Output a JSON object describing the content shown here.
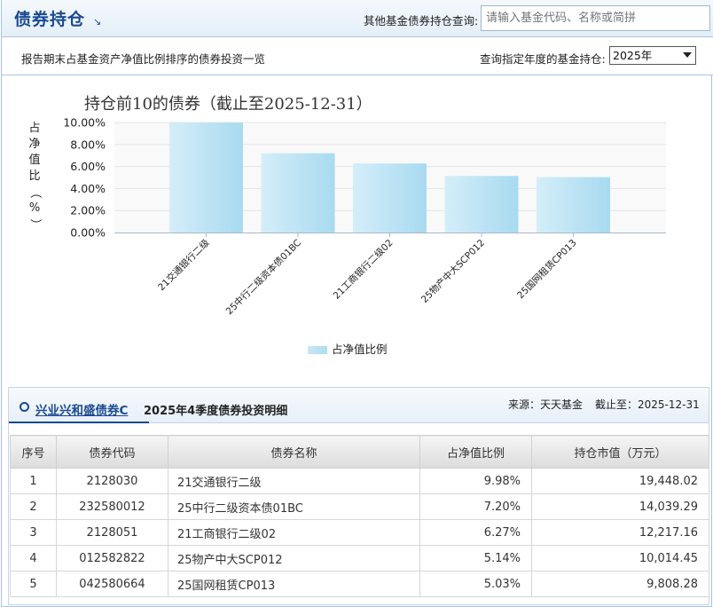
{
  "header": {
    "title": "债券持仓",
    "search_label": "其他基金债券持仓查询:",
    "search_placeholder": "请输入基金代码、名称或简拼"
  },
  "subbar": {
    "description": "报告期末占基金资产净值比例排序的债券投资一览",
    "year_label": "查询指定年度的基金持仓:",
    "year_selected": "2025年"
  },
  "chart_data": {
    "type": "bar",
    "title": "持仓前10的债券（截止至2025-12-31）",
    "ylabel": "占净值比（%）",
    "xlabel": "",
    "categories": [
      "21交通银行二级",
      "25中行二级资本债01BC",
      "21工商银行二级02",
      "25物产中大SCP012",
      "25国网租赁CP013"
    ],
    "series": [
      {
        "name": "占净值比例",
        "values": [
          9.98,
          7.2,
          6.27,
          5.14,
          5.03
        ]
      }
    ],
    "y_ticks": [
      "0.00%",
      "2.00%",
      "4.00%",
      "6.00%",
      "8.00%",
      "10.00%"
    ],
    "ylim": [
      0,
      10
    ],
    "grid": true,
    "legend": "bottom",
    "bar_color_start": "#d4eef9",
    "bar_color_end": "#a8daf0"
  },
  "detail": {
    "fund_name": "兴业兴和盛债券C",
    "title": "2025年4季度债券投资明细",
    "source": "来源：天天基金",
    "deadline": "截止至：2025-12-31",
    "columns": [
      "序号",
      "债券代码",
      "债券名称",
      "占净值比例",
      "持仓市值（万元）"
    ],
    "rows": [
      [
        "1",
        "2128030",
        "21交通银行二级",
        "9.98%",
        "19,448.02"
      ],
      [
        "2",
        "232580012",
        "25中行二级资本债01BC",
        "7.20%",
        "14,039.29"
      ],
      [
        "3",
        "2128051",
        "21工商银行二级02",
        "6.27%",
        "12,217.16"
      ],
      [
        "4",
        "012582822",
        "25物产中大SCP012",
        "5.14%",
        "10,014.45"
      ],
      [
        "5",
        "042580664",
        "25国网租赁CP013",
        "5.03%",
        "9,808.28"
      ]
    ]
  },
  "colors": {
    "accent": "#1a4a8f",
    "border": "#a9c3de"
  }
}
